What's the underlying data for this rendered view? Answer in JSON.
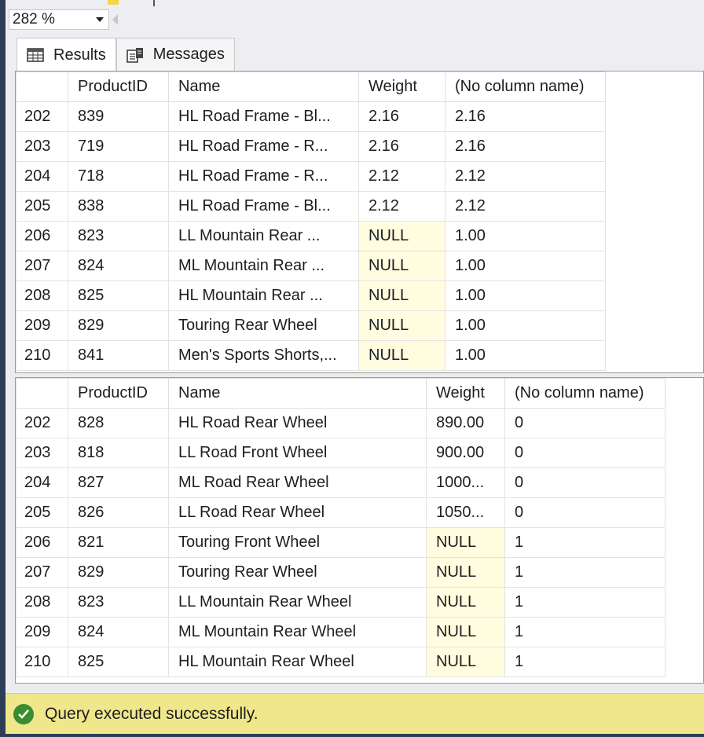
{
  "zoom": {
    "value": "282 %"
  },
  "tabs": [
    {
      "label": "Results",
      "icon": "grid-icon"
    },
    {
      "label": "Messages",
      "icon": "messages-icon"
    }
  ],
  "grid1": {
    "headers": [
      "",
      "ProductID",
      "Name",
      "Weight",
      "(No column name)"
    ],
    "rows": [
      [
        "202",
        "839",
        "HL Road Frame - Bl...",
        "2.16",
        "2.16"
      ],
      [
        "203",
        "719",
        "HL Road Frame - R...",
        "2.16",
        "2.16"
      ],
      [
        "204",
        "718",
        "HL Road Frame - R...",
        "2.12",
        "2.12"
      ],
      [
        "205",
        "838",
        "HL Road Frame - Bl...",
        "2.12",
        "2.12"
      ],
      [
        "206",
        "823",
        "LL Mountain Rear ...",
        "NULL",
        "1.00"
      ],
      [
        "207",
        "824",
        "ML Mountain Rear ...",
        "NULL",
        "1.00"
      ],
      [
        "208",
        "825",
        "HL Mountain Rear ...",
        "NULL",
        "1.00"
      ],
      [
        "209",
        "829",
        "Touring Rear Wheel",
        "NULL",
        "1.00"
      ],
      [
        "210",
        "841",
        "Men's Sports Shorts,...",
        "NULL",
        "1.00"
      ]
    ]
  },
  "grid2": {
    "headers": [
      "",
      "ProductID",
      "Name",
      "Weight",
      "(No column name)"
    ],
    "rows": [
      [
        "202",
        "828",
        "HL Road Rear Wheel",
        "890.00",
        "0"
      ],
      [
        "203",
        "818",
        "LL Road Front Wheel",
        "900.00",
        "0"
      ],
      [
        "204",
        "827",
        "ML Road Rear Wheel",
        "1000...",
        "0"
      ],
      [
        "205",
        "826",
        "LL Road Rear Wheel",
        "1050...",
        "0"
      ],
      [
        "206",
        "821",
        "Touring Front Wheel",
        "NULL",
        "1"
      ],
      [
        "207",
        "829",
        "Touring Rear Wheel",
        "NULL",
        "1"
      ],
      [
        "208",
        "823",
        "LL Mountain Rear Wheel",
        "NULL",
        "1"
      ],
      [
        "209",
        "824",
        "ML Mountain Rear Wheel",
        "NULL",
        "1"
      ],
      [
        "210",
        "825",
        "HL Mountain Rear Wheel",
        "NULL",
        "1"
      ]
    ]
  },
  "status": {
    "text": "Query executed successfully.",
    "color": "#f0e68c"
  },
  "colors": {
    "null_cell": "#fffce0",
    "success": "#3a8d2f"
  }
}
